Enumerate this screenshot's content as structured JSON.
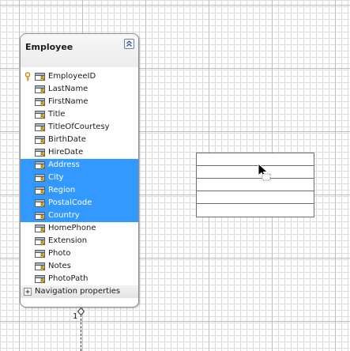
{
  "entity": {
    "title": "Employee",
    "key_property": "EmployeeID",
    "properties": [
      {
        "label": "LastName",
        "selected": false
      },
      {
        "label": "FirstName",
        "selected": false
      },
      {
        "label": "Title",
        "selected": false
      },
      {
        "label": "TitleOfCourtesy",
        "selected": false
      },
      {
        "label": "BirthDate",
        "selected": false
      },
      {
        "label": "HireDate",
        "selected": false
      },
      {
        "label": "Address",
        "selected": true
      },
      {
        "label": "City",
        "selected": true
      },
      {
        "label": "Region",
        "selected": true
      },
      {
        "label": "PostalCode",
        "selected": true
      },
      {
        "label": "Country",
        "selected": true
      },
      {
        "label": "HomePhone",
        "selected": false
      },
      {
        "label": "Extension",
        "selected": false
      },
      {
        "label": "Photo",
        "selected": false
      },
      {
        "label": "Notes",
        "selected": false
      },
      {
        "label": "PhotoPath",
        "selected": false
      }
    ],
    "navigation_label": "Navigation properties"
  },
  "association": {
    "multiplicity": "1"
  },
  "colors": {
    "selection": "#3399ff",
    "grid_minor": "#dcdcdc",
    "grid_major": "#bdbdbd"
  },
  "icons": {
    "key": "key-icon",
    "property": "property-icon",
    "collapse": "collapse-chevron-icon",
    "expand": "plus-icon",
    "cursor": "move-cursor-icon"
  }
}
